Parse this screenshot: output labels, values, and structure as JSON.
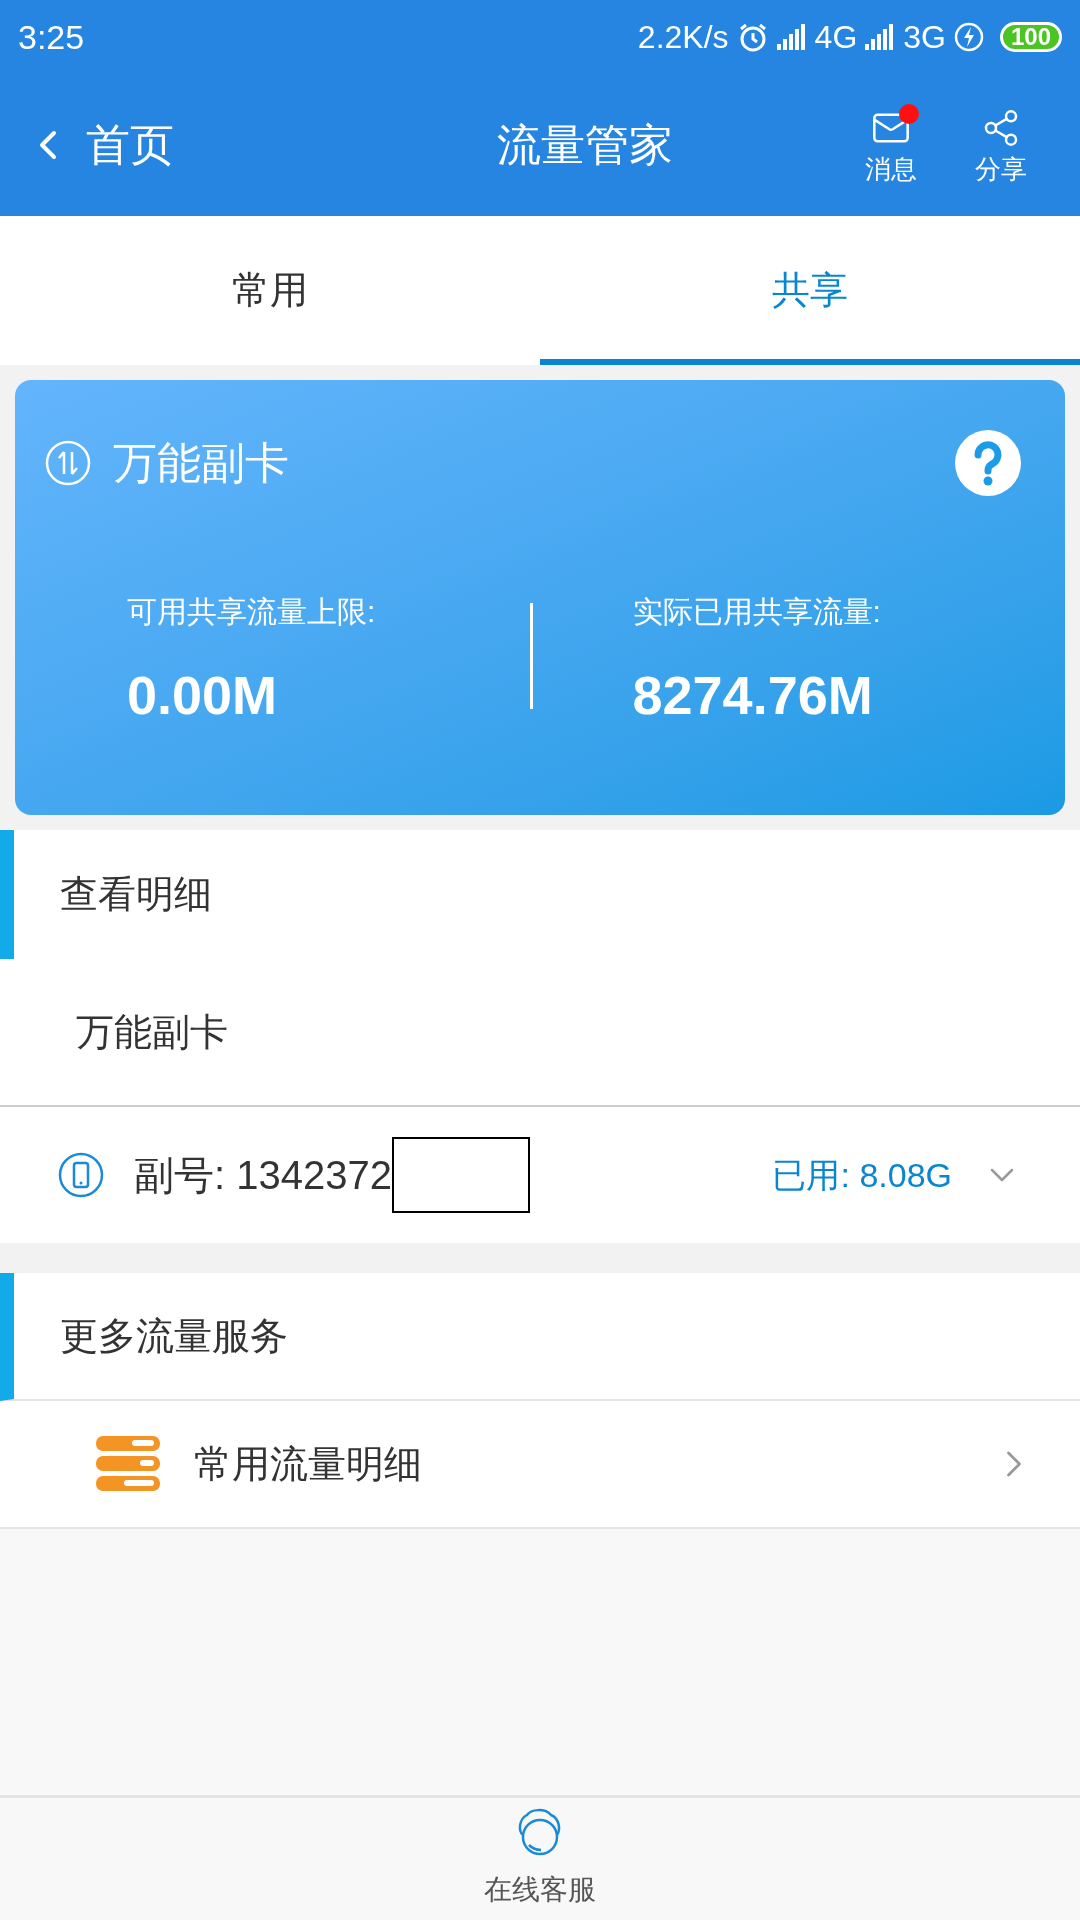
{
  "status_bar": {
    "time": "3:25",
    "speed": "2.2K/s",
    "network_1": "4G",
    "network_2": "3G",
    "battery": "100"
  },
  "header": {
    "back_label": "首页",
    "title": "流量管家",
    "actions": [
      {
        "label": "消息",
        "kind": "mail",
        "badge": true
      },
      {
        "label": "分享",
        "kind": "share",
        "badge": false
      }
    ]
  },
  "tabs": [
    {
      "label": "常用",
      "selected": false
    },
    {
      "label": "共享",
      "selected": true
    }
  ],
  "card": {
    "title": "万能副卡",
    "stats": [
      {
        "label": "可用共享流量上限:",
        "value": "0.00M"
      },
      {
        "label": "实际已用共享流量:",
        "value": "8274.76M"
      }
    ]
  },
  "detail_section": {
    "heading": "查看明细",
    "subheading": "万能副卡",
    "line": {
      "number": "副号: 1342372",
      "usage": "已用: 8.08G",
      "expanded": false
    }
  },
  "more_section": {
    "heading": "更多流量服务",
    "items": [
      {
        "label": "常用流量明细"
      }
    ]
  },
  "bottom_bar": {
    "label": "在线客服"
  }
}
